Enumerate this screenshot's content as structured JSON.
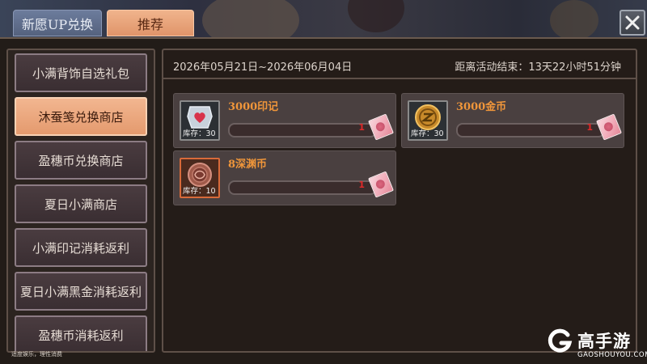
{
  "tabs": [
    {
      "label": "新愿UP兑换",
      "active": false
    },
    {
      "label": "推荐",
      "active": true
    }
  ],
  "close_icon": "close-icon",
  "sidebar": {
    "items": [
      {
        "label": "小满背饰自选礼包",
        "active": false
      },
      {
        "label": "沐蚕笺兑换商店",
        "active": true
      },
      {
        "label": "盈穗币兑换商店",
        "active": false
      },
      {
        "label": "夏日小满商店",
        "active": false
      },
      {
        "label": "小满印记消耗返利",
        "active": false
      },
      {
        "label": "夏日小满黑金消耗返利",
        "active": false
      },
      {
        "label": "盈穗币消耗返利",
        "active": false
      }
    ]
  },
  "tagline": "适度娱乐，理性消费",
  "main": {
    "date_range": "2026年05月21日~2026年06月04日",
    "countdown": "距离活动结束：13天22小时51分钟"
  },
  "items": [
    {
      "title": "3000印记",
      "stock": "库存：30",
      "count": "1",
      "icon": "heart-seal-icon",
      "progress": 0.0
    },
    {
      "title": "3000金币",
      "stock": "库存：30",
      "count": "1",
      "icon": "gold-coin-icon",
      "progress": 0.0
    },
    {
      "title": "8深渊币",
      "stock": "库存：10",
      "count": "1",
      "icon": "abyss-coin-icon",
      "progress": 0.0
    }
  ],
  "watermark": {
    "name": "高手游",
    "domain": "GAOSHOUYOU.COM"
  },
  "colors": {
    "accent": "#f0963a",
    "active_tab": "#e0946a",
    "count_red": "#e02a2a"
  }
}
